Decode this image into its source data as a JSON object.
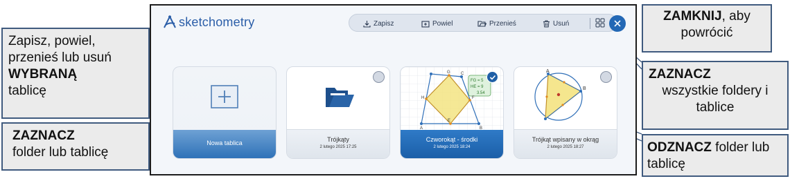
{
  "app": {
    "logo_text": "sketchometry"
  },
  "toolbar": {
    "save_label": "Zapisz",
    "duplicate_label": "Powiel",
    "move_label": "Przenieś",
    "delete_label": "Usuń",
    "select_all_icon": "grid-select-icon",
    "close_icon": "close-icon"
  },
  "cards": [
    {
      "title": "Nowa tablica",
      "date": "",
      "kind": "new"
    },
    {
      "title": "Trójkąty",
      "date": "2 lutego 2025 17:25",
      "kind": "folder",
      "selected": false
    },
    {
      "title": "Czworokąt - środki",
      "date": "2 lutego 2025 18:24",
      "kind": "board",
      "selected": true,
      "preview_labels": [
        "G",
        "C",
        "H",
        "F",
        "E",
        "A",
        "B",
        "FG = 5",
        "HE = 9",
        "3.54"
      ]
    },
    {
      "title": "Trójkąt wpisany w okrąg",
      "date": "2 lutego 2025 18:27",
      "kind": "board",
      "selected": false,
      "preview_labels": [
        "A",
        "B"
      ]
    }
  ],
  "callouts": {
    "close": {
      "bold": "ZAMKNIJ",
      "rest": ", aby powrócić"
    },
    "actions": {
      "text": "Zapisz, powiel, przenieś lub usuń",
      "bold": "WYBRANĄ",
      "rest": "tablicę"
    },
    "select_item": {
      "bold": "ZAZNACZ",
      "rest": "folder lub tablicę"
    },
    "select_all": {
      "bold": "ZAZNACZ",
      "rest": "wszystkie foldery i tablice"
    },
    "deselect": {
      "bold": "ODZNACZ",
      "rest": " folder lub tablicę"
    }
  },
  "colors": {
    "accent": "#2368b5",
    "callout_border": "#3f5a7e",
    "callout_bg": "#ebebeb"
  }
}
